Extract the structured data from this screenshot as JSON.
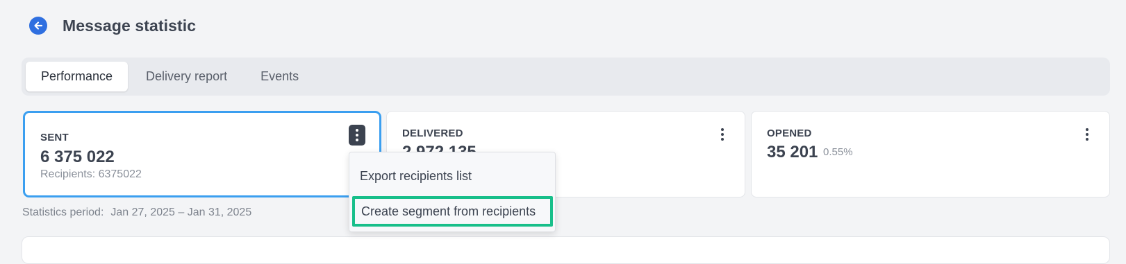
{
  "header": {
    "title": "Message statistic",
    "back_icon": "arrow-left-icon"
  },
  "tabs": [
    {
      "label": "Performance",
      "active": true
    },
    {
      "label": "Delivery report",
      "active": false
    },
    {
      "label": "Events",
      "active": false
    }
  ],
  "cards": {
    "sent": {
      "label": "SENT",
      "value": "6 375 022",
      "sub": "Recipients: 6375022"
    },
    "delivered": {
      "label": "DELIVERED",
      "value": "2 972 135"
    },
    "opened": {
      "label": "OPENED",
      "value": "35 201",
      "pct": "0.55%"
    }
  },
  "menu": {
    "items": [
      "Export recipients list",
      "Create segment from recipients"
    ],
    "highlight_color": "#18bf8a"
  },
  "period": {
    "label": "Statistics period:",
    "value": "Jan 27, 2025 – Jan 31, 2025"
  },
  "colors": {
    "accent": "#2f6fe0",
    "card_selected_border": "#3b9ff0"
  }
}
